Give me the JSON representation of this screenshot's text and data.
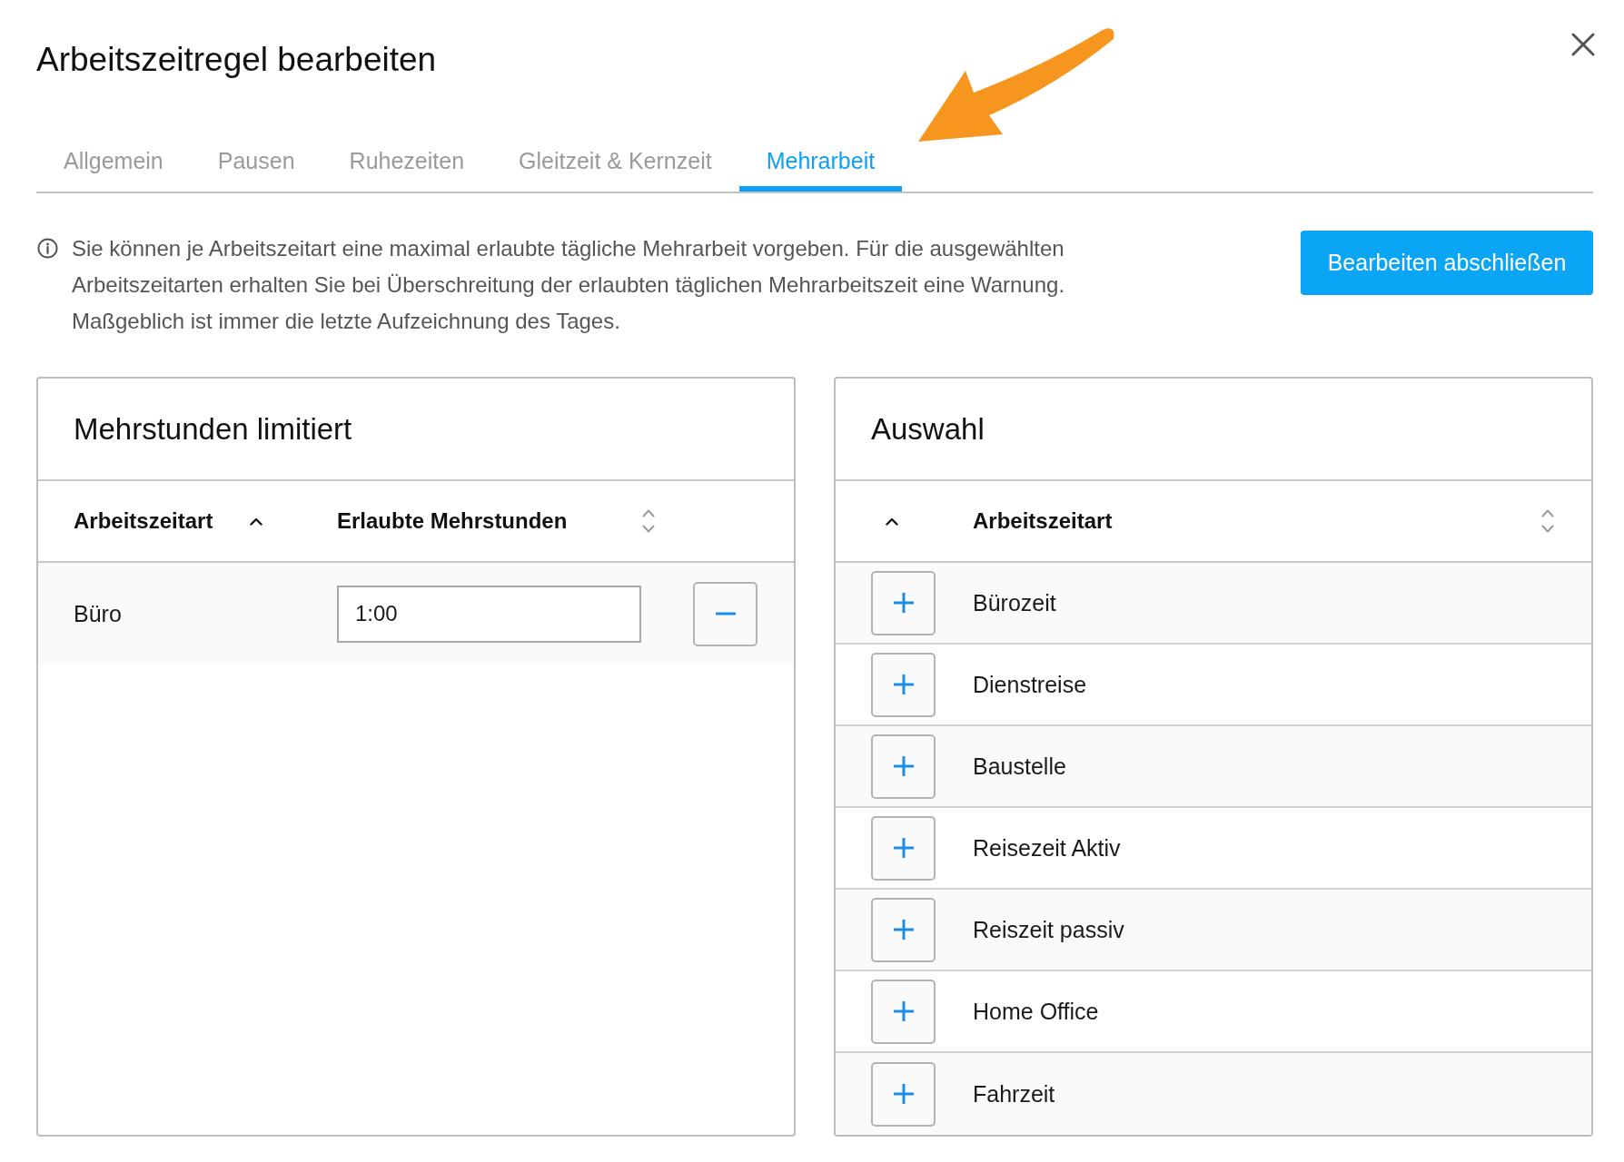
{
  "dialog": {
    "title": "Arbeitszeitregel bearbeiten"
  },
  "tabs": [
    {
      "label": "Allgemein",
      "selected": false
    },
    {
      "label": "Pausen",
      "selected": false
    },
    {
      "label": "Ruhezeiten",
      "selected": false
    },
    {
      "label": "Gleitzeit & Kernzeit",
      "selected": false
    },
    {
      "label": "Mehrarbeit",
      "selected": true
    }
  ],
  "info": {
    "text": "Sie können je Arbeitszeitart eine maximal erlaubte tägliche Mehrarbeit vorgeben. Für die ausgewählten Arbeitszeitarten erhalten Sie bei Überschreitung der erlaubten täglichen Mehrarbeitszeit eine Warnung. Maßgeblich ist immer die letzte Aufzeichnung des Tages."
  },
  "finish_button": {
    "label": "Bearbeiten abschließen"
  },
  "limited_panel": {
    "title": "Mehrstunden limitiert",
    "columns": [
      {
        "label": "Arbeitszeitart",
        "sorted": true
      },
      {
        "label": "Erlaubte Mehrstunden",
        "sorted": false
      }
    ],
    "rows": [
      {
        "name": "Büro",
        "hours": "1:00"
      }
    ]
  },
  "selection_panel": {
    "title": "Auswahl",
    "columns": [
      {
        "sorted": true
      },
      {
        "label": "Arbeitszeitart",
        "sorted": false
      }
    ],
    "rows": [
      {
        "name": "Bürozeit"
      },
      {
        "name": "Dienstreise"
      },
      {
        "name": "Baustelle"
      },
      {
        "name": "Reisezeit Aktiv"
      },
      {
        "name": "Reiszeit passiv"
      },
      {
        "name": "Home Office"
      },
      {
        "name": "Fahrzeit"
      }
    ]
  }
}
